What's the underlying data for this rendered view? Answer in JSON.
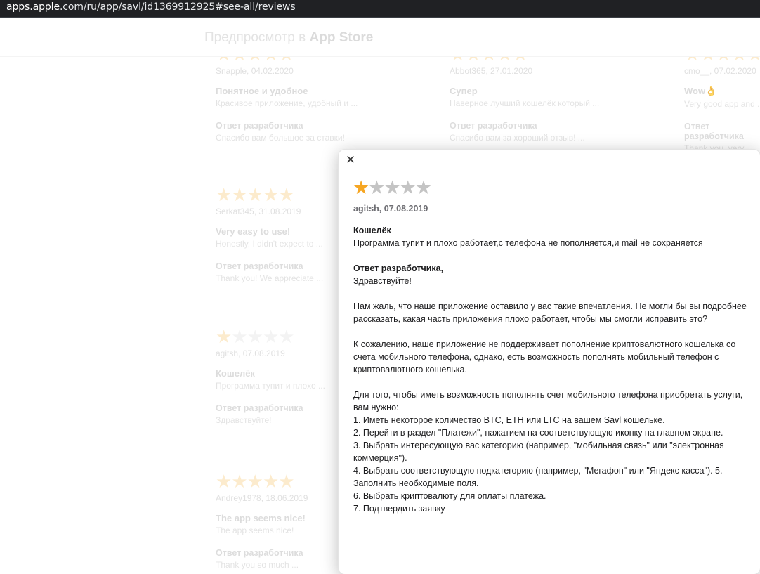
{
  "browser": {
    "url_host": "apps.apple",
    "url_rest": ".com/ru/app/savl/id1369912925#see-all/reviews"
  },
  "header": {
    "title_prefix": "Предпросмотр в ",
    "title_brand": "App Store"
  },
  "background_reviews": [
    {
      "rating": 5,
      "meta": "Snapple, 04.02.2020",
      "title": "Понятное и удобное",
      "body": "Красивое приложение, удобный и ...",
      "dev_label": "Ответ разработчика",
      "dev_body": "Спасибо вам большое за ставки!"
    },
    {
      "rating": 5,
      "meta": "Abbot365, 27.01.2020",
      "title": "Супер",
      "body": "Наверное лучший кошелёк который ...",
      "dev_label": "Ответ разработчика",
      "dev_body": "Спасибо вам за хороший отзыв! ..."
    },
    {
      "rating": 5,
      "meta": "cmo__, 07.02.2020",
      "title": "Wow👌",
      "body": "Very good app and ...",
      "dev_label": "Ответ разработчика",
      "dev_body": "Thank you, very ..."
    },
    {
      "rating": 5,
      "meta": "Serkat345, 31.08.2019",
      "title": "Very easy to use!",
      "body": "Honestly, I didn't expect to ...",
      "dev_label": "Ответ разработчика",
      "dev_body": "Thank you! We appreciate ..."
    },
    {
      "rating": 1,
      "meta": "agitsh, 07.08.2019",
      "title": "Кошелёк",
      "body": "Программа тупит и плохо ...",
      "dev_label": "Ответ разработчика",
      "dev_body": "Здравствуйте!"
    },
    {
      "rating": 5,
      "meta": "Andrey1978, 18.06.2019",
      "title": "The app seems nice!",
      "body": "The app seems nice!",
      "dev_label": "Ответ разработчика",
      "dev_body": "Thank you so much ..."
    }
  ],
  "modal": {
    "close_glyph": "✕",
    "rating": 1,
    "max_rating": 5,
    "meta": "agitsh, 07.08.2019",
    "title": "Кошелёк",
    "body": "Программа тупит и плохо работает,с телефона не пополняется,и mail не сохраняется",
    "dev_label": "Ответ разработчика,",
    "dev_greeting": "Здравствуйте!",
    "dev_p1": "Нам жаль, что наше приложение оставило у вас такие впечатления. Не могли бы вы подробнее рассказать, какая часть приложения плохо работает, чтобы мы смогли исправить это?",
    "dev_p2": "К сожалению, наше приложение не поддерживает пополнение криптовалютного кошелька со счета мобильного телефона, однако, есть возможность пополнять мобильный телефон с криптовалютного кошелька.",
    "dev_p3_intro": "Для того, чтобы иметь возможность пополнять счет мобильного телефона приобретать услуги, вам нужно:",
    "dev_steps": [
      "1. Иметь некоторое количество BTC, ETH или LTC на вашем Savl кошельке.",
      "2. Перейти в раздел \"Платежи\", нажатием на соответствующую иконку на главном экране.",
      "3. Выбрать интересующую вас категорию (например, \"мобильная связь\" или \"электронная коммерция\").",
      "4. Выбрать соответствующую подкатегорию (например, \"Мегафон\" или \"Яндекс касса\"). 5. Заполнить необходимые поля.",
      "6. Выбрать криптовалюту для оплаты платежа.",
      "7. Подтвердить заявку"
    ]
  },
  "colors": {
    "star_active": "#f6a623",
    "star_inactive": "#c4c4c4"
  }
}
